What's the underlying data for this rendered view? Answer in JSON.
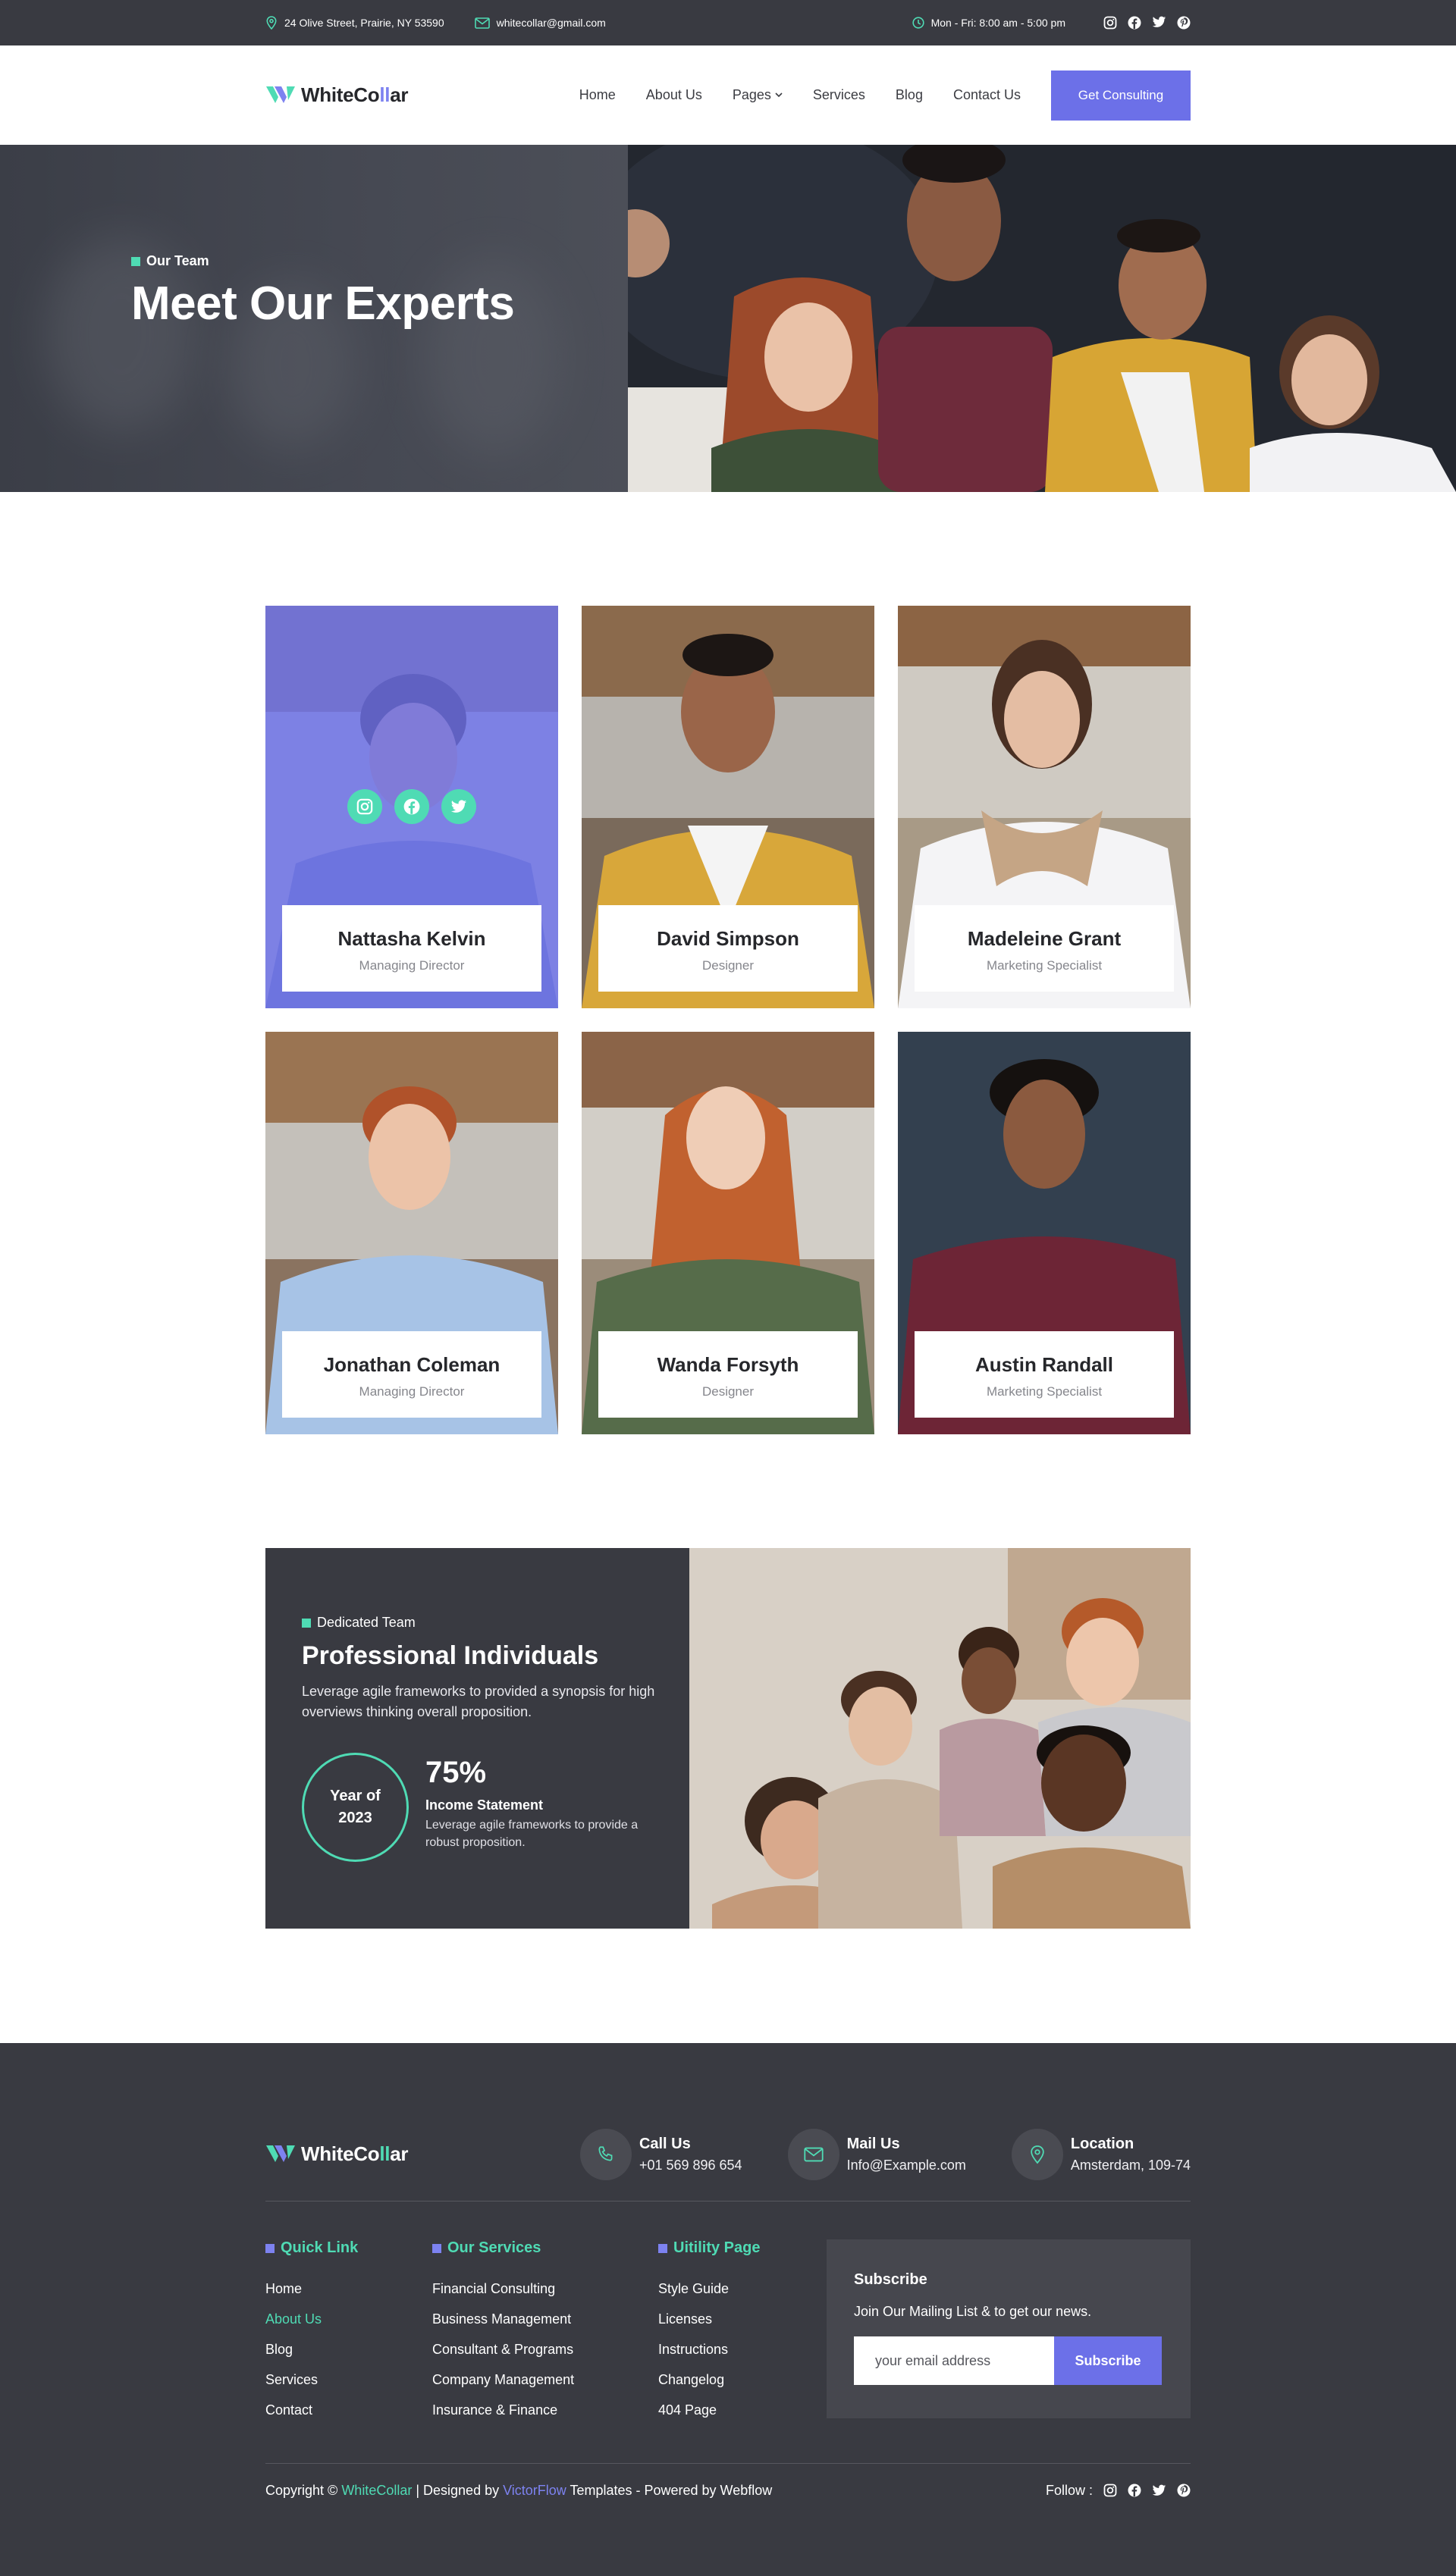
{
  "topbar": {
    "address": "24 Olive Street, Prairie, NY 53590",
    "email": "whitecollar@gmail.com",
    "hours": "Mon - Fri: 8:00 am - 5:00 pm",
    "social_icons": [
      "instagram-icon",
      "facebook-icon",
      "twitter-icon",
      "pinterest-icon"
    ]
  },
  "brand": {
    "name_part1": "WhiteCo",
    "name_highlight": "ll",
    "name_part2": "ar"
  },
  "nav": {
    "items": [
      "Home",
      "About Us",
      "Pages",
      "Services",
      "Blog",
      "Contact Us"
    ],
    "cta": "Get Consulting"
  },
  "hero": {
    "eyebrow": "Our Team",
    "title": "Meet Our Experts"
  },
  "team": {
    "members": [
      {
        "name": "Nattasha Kelvin",
        "role": "Managing Director"
      },
      {
        "name": "David Simpson",
        "role": "Designer"
      },
      {
        "name": "Madeleine Grant",
        "role": "Marketing Specialist"
      },
      {
        "name": "Jonathan Coleman",
        "role": "Managing Director"
      },
      {
        "name": "Wanda Forsyth",
        "role": "Designer"
      },
      {
        "name": "Austin Randall",
        "role": "Marketing Specialist"
      }
    ]
  },
  "pro": {
    "eyebrow": "Dedicated Team",
    "title": "Professional Individuals",
    "text": "Leverage agile frameworks to provided  a synopsis for high overviews thinking overall proposition.",
    "ring_line1": "Year of",
    "ring_line2": "2023",
    "stat_value": "75%",
    "stat_label": "Income Statement",
    "stat_desc": "Leverage agile frameworks to provide a robust proposition."
  },
  "footer": {
    "contacts": [
      {
        "title": "Call Us",
        "value": "+01 569 896 654"
      },
      {
        "title": "Mail Us",
        "value": "Info@Example.com"
      },
      {
        "title": "Location",
        "value": "Amsterdam, 109-74"
      }
    ],
    "quick_link": {
      "title": "Quick Link",
      "items": [
        "Home",
        "About Us",
        "Blog",
        "Services",
        "Contact"
      ]
    },
    "services": {
      "title": "Our Services",
      "items": [
        "Financial Consulting",
        "Business Management",
        "Consultant & Programs",
        "Company Management",
        "Insurance & Finance"
      ]
    },
    "utility": {
      "title": "Uitility Page",
      "items": [
        "Style Guide",
        "Licenses",
        "Instructions",
        "Changelog",
        "404 Page"
      ]
    },
    "subscribe": {
      "title": "Subscribe",
      "text": "Join Our Mailing List & to get our news.",
      "placeholder": "your email address",
      "button": "Subscribe"
    },
    "copyright": {
      "prefix": "Copyright © ",
      "brand": "WhiteCollar",
      "mid": " | Designed by ",
      "designer": "VictorFlow",
      "suffix": " Templates - Powered by Webflow"
    },
    "follow": "Follow :"
  },
  "colors": {
    "accent_purple": "#6c70e8",
    "accent_green": "#4fdbb4",
    "dark": "#393a41"
  }
}
